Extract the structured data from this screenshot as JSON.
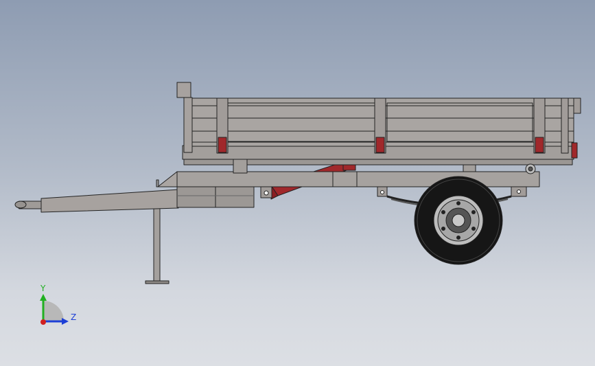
{
  "triad": {
    "y_label": "Y",
    "z_label": "Z",
    "colors": {
      "y": "#21b021",
      "z": "#1d3fd6",
      "x": "#d02020"
    }
  },
  "colors": {
    "steel": "#a19c99",
    "steel_dark": "#8a8582",
    "outline": "#222222",
    "red_part": "#a0282b",
    "tire": "#161616",
    "hub": "#bdbdbd"
  }
}
